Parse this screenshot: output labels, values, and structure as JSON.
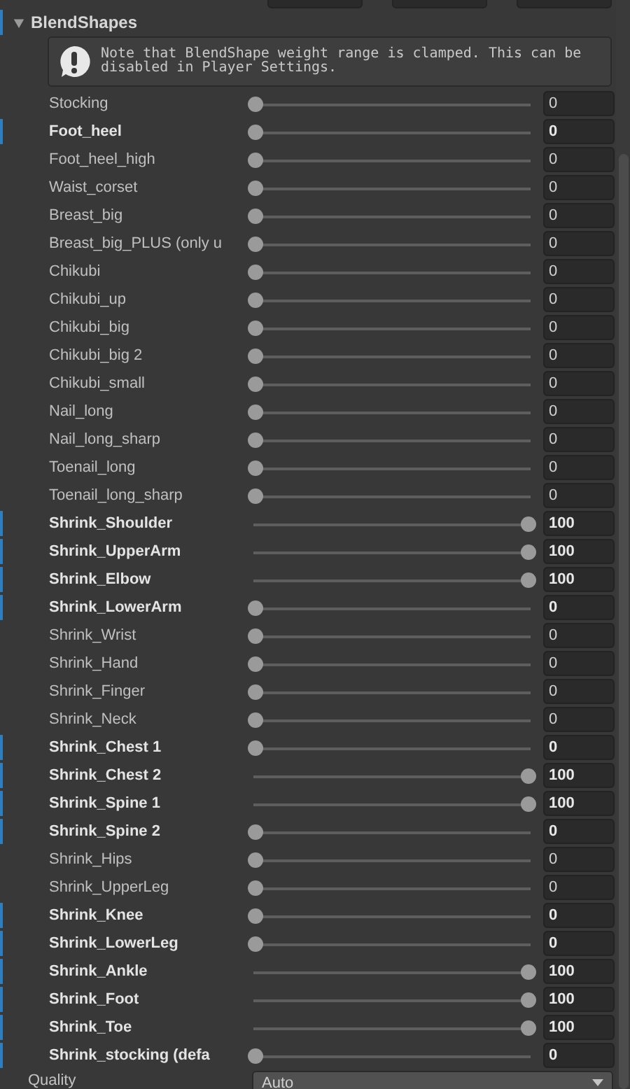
{
  "section": {
    "title": "BlendShapes",
    "expanded": true,
    "modified": true
  },
  "help_box": {
    "text": "Note that BlendShape weight range is clamped. This can be disabled in Player Settings."
  },
  "blendshapes": [
    {
      "name": "Stocking",
      "level": 0,
      "value": "0",
      "modified": false
    },
    {
      "name": "Foot_heel",
      "level": 0,
      "value": "0",
      "modified": true
    },
    {
      "name": "Foot_heel_high",
      "level": 0,
      "value": "0",
      "modified": false
    },
    {
      "name": "Waist_corset",
      "level": 0,
      "value": "0",
      "modified": false
    },
    {
      "name": "Breast_big",
      "level": 0,
      "value": "0",
      "modified": false
    },
    {
      "name": "Breast_big_PLUS (only u",
      "level": 0,
      "value": "0",
      "modified": false
    },
    {
      "name": "Chikubi",
      "level": 0,
      "value": "0",
      "modified": false
    },
    {
      "name": "Chikubi_up",
      "level": 0,
      "value": "0",
      "modified": false
    },
    {
      "name": "Chikubi_big",
      "level": 0,
      "value": "0",
      "modified": false
    },
    {
      "name": "Chikubi_big 2",
      "level": 0,
      "value": "0",
      "modified": false
    },
    {
      "name": "Chikubi_small",
      "level": 0,
      "value": "0",
      "modified": false
    },
    {
      "name": "Nail_long",
      "level": 0,
      "value": "0",
      "modified": false
    },
    {
      "name": "Nail_long_sharp",
      "level": 0,
      "value": "0",
      "modified": false
    },
    {
      "name": "Toenail_long",
      "level": 0,
      "value": "0",
      "modified": false
    },
    {
      "name": "Toenail_long_sharp",
      "level": 0,
      "value": "0",
      "modified": false
    },
    {
      "name": "Shrink_Shoulder",
      "level": 1,
      "value": "100",
      "modified": true
    },
    {
      "name": "Shrink_UpperArm",
      "level": 1,
      "value": "100",
      "modified": true
    },
    {
      "name": "Shrink_Elbow",
      "level": 1,
      "value": "100",
      "modified": true
    },
    {
      "name": "Shrink_LowerArm",
      "level": 0,
      "value": "0",
      "modified": true
    },
    {
      "name": "Shrink_Wrist",
      "level": 0,
      "value": "0",
      "modified": false
    },
    {
      "name": "Shrink_Hand",
      "level": 0,
      "value": "0",
      "modified": false
    },
    {
      "name": "Shrink_Finger",
      "level": 0,
      "value": "0",
      "modified": false
    },
    {
      "name": "Shrink_Neck",
      "level": 0,
      "value": "0",
      "modified": false
    },
    {
      "name": "Shrink_Chest 1",
      "level": 0,
      "value": "0",
      "modified": true
    },
    {
      "name": "Shrink_Chest 2",
      "level": 1,
      "value": "100",
      "modified": true
    },
    {
      "name": "Shrink_Spine 1",
      "level": 1,
      "value": "100",
      "modified": true
    },
    {
      "name": "Shrink_Spine 2",
      "level": 0,
      "value": "0",
      "modified": true
    },
    {
      "name": "Shrink_Hips",
      "level": 0,
      "value": "0",
      "modified": false
    },
    {
      "name": "Shrink_UpperLeg",
      "level": 0,
      "value": "0",
      "modified": false
    },
    {
      "name": "Shrink_Knee",
      "level": 0,
      "value": "0",
      "modified": true
    },
    {
      "name": "Shrink_LowerLeg",
      "level": 0,
      "value": "0",
      "modified": true
    },
    {
      "name": "Shrink_Ankle",
      "level": 1,
      "value": "100",
      "modified": true
    },
    {
      "name": "Shrink_Foot",
      "level": 1,
      "value": "100",
      "modified": true
    },
    {
      "name": "Shrink_Toe",
      "level": 1,
      "value": "100",
      "modified": true
    },
    {
      "name": "Shrink_stocking (defa",
      "level": 0,
      "value": "0",
      "modified": true
    }
  ],
  "quality_row": {
    "label": "Quality",
    "value": "Auto"
  }
}
